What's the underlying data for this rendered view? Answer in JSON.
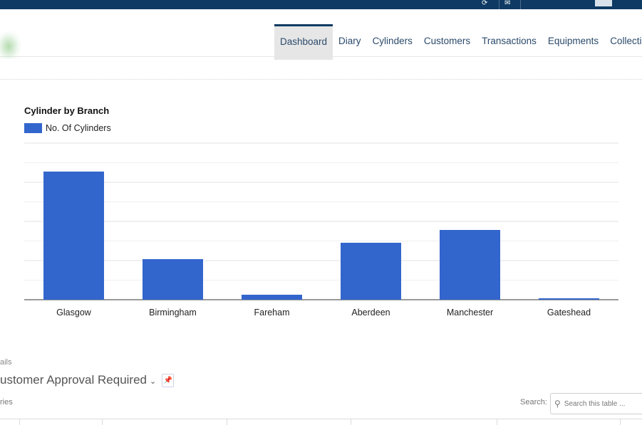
{
  "header": {
    "nav": [
      {
        "label": "Dashboard",
        "active": true
      },
      {
        "label": "Diary",
        "active": false
      },
      {
        "label": "Cylinders",
        "active": false
      },
      {
        "label": "Customers",
        "active": false
      },
      {
        "label": "Transactions",
        "active": false
      },
      {
        "label": "Equipments",
        "active": false
      },
      {
        "label": "Collection",
        "active": false
      }
    ]
  },
  "chart_data": {
    "type": "bar",
    "title": "Cylinder by Branch",
    "categories": [
      "Glasgow",
      "Birmingham",
      "Fareham",
      "Aberdeen",
      "Manchester",
      "Gateshead"
    ],
    "series": [
      {
        "name": "No. Of Cylinders",
        "color": "#3366cc",
        "values": [
          180,
          57,
          7,
          80,
          98,
          2
        ]
      }
    ],
    "ylim": [
      0,
      220
    ],
    "grid": true,
    "legend": "top-left",
    "xlabel": "",
    "ylabel": ""
  },
  "section": {
    "label": "ails",
    "title": "ustomer Approval Required",
    "entries_label": "ries"
  },
  "search": {
    "label": "Search:",
    "placeholder": "Search this table ..."
  },
  "icons": {
    "topbar": [
      "refresh-icon",
      "notification-icon"
    ],
    "chevron": "chevron-down-icon",
    "pin": "pin-icon",
    "search": "search-icon"
  }
}
